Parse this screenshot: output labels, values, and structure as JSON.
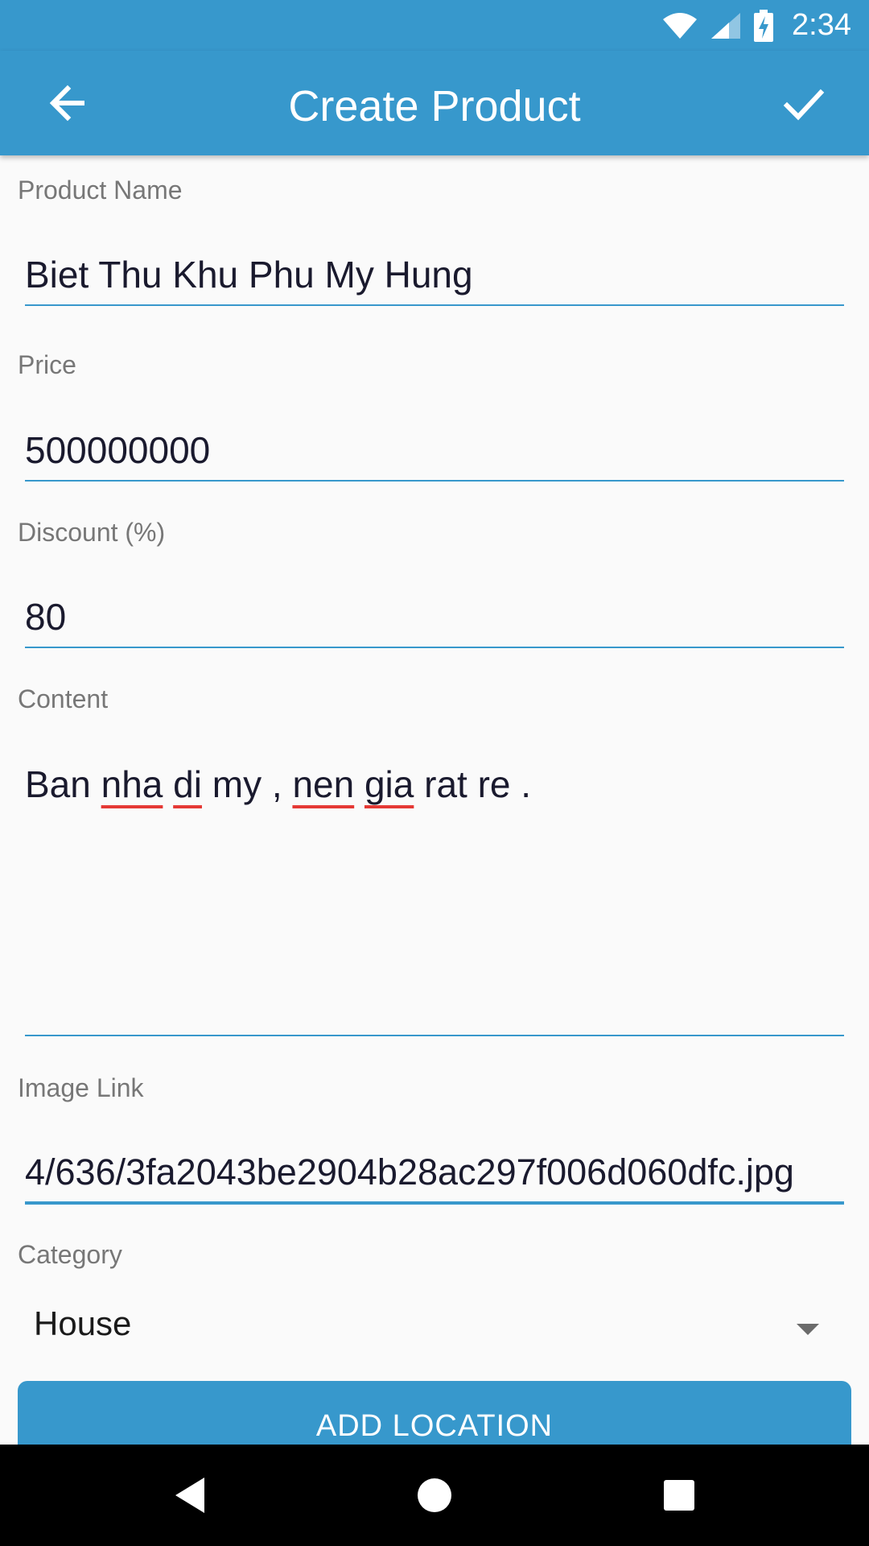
{
  "status_bar": {
    "time": "2:34",
    "icons": [
      "wifi-icon",
      "cellular-signal-icon",
      "battery-charging-icon"
    ]
  },
  "app_bar": {
    "title": "Create Product",
    "back_icon": "arrow-left-icon",
    "confirm_icon": "check-icon"
  },
  "form": {
    "product_name": {
      "label": "Product Name",
      "value": "Biet Thu Khu Phu My Hung"
    },
    "price": {
      "label": "Price",
      "value": "500000000"
    },
    "discount": {
      "label": "Discount (%)",
      "value": "80"
    },
    "content": {
      "label": "Content",
      "value": "Ban nha di my , nen gia rat re .",
      "words": {
        "w1": "Ban",
        "w2": "nha",
        "w3": "di",
        "w4": "my ,",
        "w5": "nen",
        "w6": "gia",
        "w7": "rat re ."
      }
    },
    "image_link": {
      "label": "Image Link",
      "value": "4/636/3fa2043be2904b28ac297f006d060dfc.jpg"
    },
    "category": {
      "label": "Category",
      "value": "House"
    }
  },
  "add_location_button": {
    "label": "ADD LOCATION"
  },
  "colors": {
    "primary": "#3798cc",
    "spellcheck": "#e53935",
    "label": "#777777",
    "nav_bar": "#000000"
  },
  "nav_bar": {
    "icons": [
      "back-triangle-icon",
      "home-circle-icon",
      "recents-square-icon"
    ]
  }
}
